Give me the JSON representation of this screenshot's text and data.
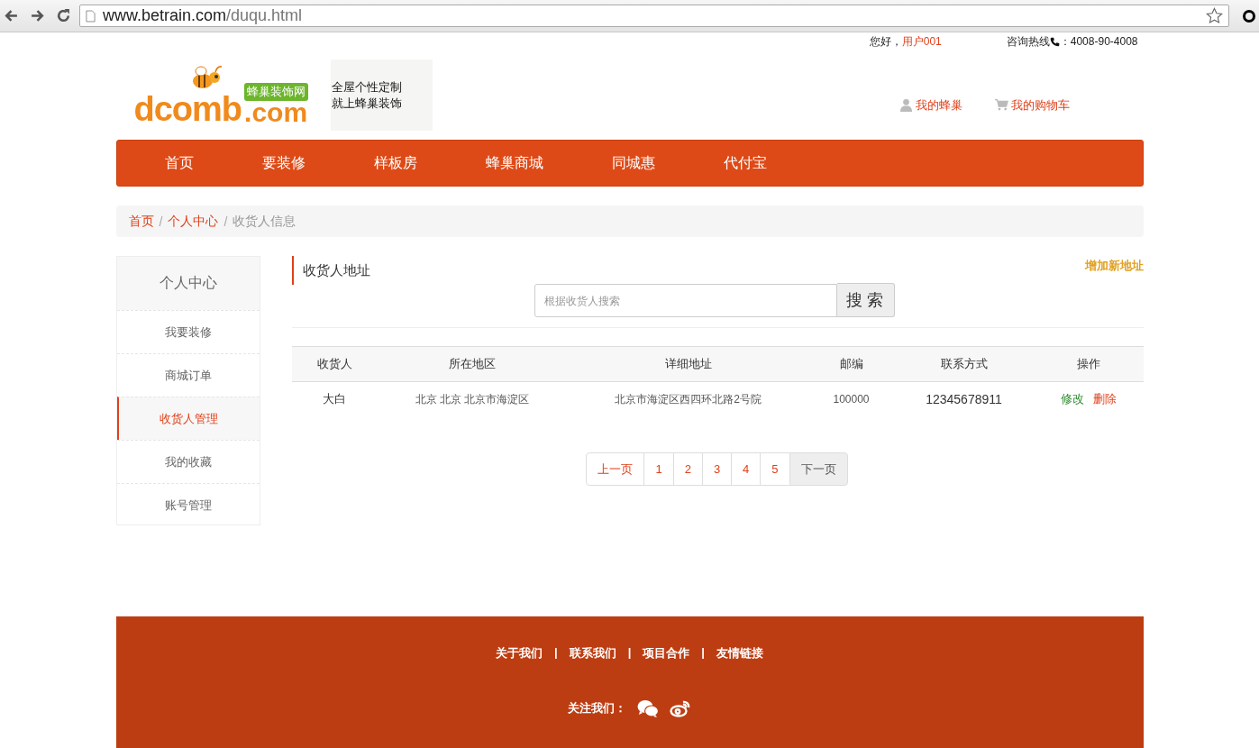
{
  "browser": {
    "url_host": "www.betrain.com",
    "url_path": "/duqu.html"
  },
  "topbar": {
    "greeting": "您好，",
    "user": "用户001",
    "hotline_label": "咨询热线",
    "hotline_number": "：4008-90-4008"
  },
  "header": {
    "logo_word": "dcomb",
    "logo_domain": ".com",
    "logo_badge": "蜂巢装饰网",
    "slogan": [
      "全屋个性定制",
      "就上蜂巢装饰"
    ],
    "links": [
      {
        "kind": "user",
        "label": "我的蜂巢"
      },
      {
        "kind": "cart",
        "label": "我的购物车"
      }
    ]
  },
  "nav": [
    {
      "label": "首页"
    },
    {
      "label": "要装修"
    },
    {
      "label": "样板房"
    },
    {
      "label": "蜂巢商城"
    },
    {
      "label": "同城惠"
    },
    {
      "label": "代付宝"
    }
  ],
  "breadcrumb": [
    {
      "label": "首页",
      "current": false
    },
    {
      "separator": "/",
      "label": "个人中心",
      "current": false
    },
    {
      "separator": "/",
      "label": "收货人信息",
      "current": true
    }
  ],
  "sidebar": {
    "title": "个人中心",
    "items": [
      {
        "label": "我要装修",
        "selected": false
      },
      {
        "label": "商城订单",
        "selected": false
      },
      {
        "label": "收货人管理",
        "selected": true
      },
      {
        "label": "我的收藏",
        "selected": false
      },
      {
        "label": "账号管理",
        "selected": false
      }
    ]
  },
  "main": {
    "title": "收货人地址",
    "add_link": "增加新地址",
    "search": {
      "placeholder": "根据收货人搜索",
      "button": "搜 索"
    },
    "table": {
      "columns": [
        "收货人",
        "所在地区",
        "详细地址",
        "邮编",
        "联系方式",
        "操作"
      ],
      "rows": [
        {
          "name": "大白",
          "region": "北京 北京 北京市海淀区",
          "address": "北京市海淀区西四环北路2号院",
          "zip": "100000",
          "phone": "12345678911",
          "actions": [
            {
              "kind": "edit",
              "label": "修改"
            },
            {
              "kind": "delete",
              "label": "删除"
            }
          ]
        }
      ]
    },
    "pagination": [
      {
        "label": "上一页",
        "highlighted": false
      },
      {
        "label": "1",
        "highlighted": false
      },
      {
        "label": "2",
        "highlighted": false
      },
      {
        "label": "3",
        "highlighted": false
      },
      {
        "label": "4",
        "highlighted": false
      },
      {
        "label": "5",
        "highlighted": false
      },
      {
        "label": "下一页",
        "highlighted": true
      }
    ]
  },
  "footer": {
    "links": [
      {
        "text": "关于我们"
      },
      {
        "separator": "|",
        "text": "联系我们"
      },
      {
        "separator": "|",
        "text": "项目合作"
      },
      {
        "separator": "|",
        "text": "友情链接"
      }
    ],
    "follow_label": "关注我们：",
    "social": [
      {
        "kind": "wechat"
      },
      {
        "kind": "weibo"
      }
    ]
  }
}
